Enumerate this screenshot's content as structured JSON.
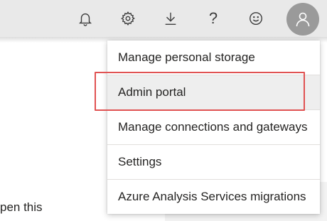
{
  "header": {
    "icons": [
      "notifications-icon",
      "gear-icon",
      "download-icon",
      "help-icon",
      "feedback-smiley-icon"
    ],
    "help_glyph": "?",
    "avatar_icon": "person-icon"
  },
  "account_menu": {
    "items": [
      {
        "label": "Manage personal storage"
      },
      {
        "label": "Admin portal",
        "state": "hovered",
        "highlighted": true
      },
      {
        "label": "Manage connections and gateways"
      },
      {
        "label": "Settings"
      },
      {
        "label": "Azure Analysis Services migrations"
      }
    ]
  },
  "background": {
    "partial_text": "pen this"
  },
  "colors": {
    "highlight_border": "#e05252",
    "avatar_bg": "#9a9a9a",
    "topbar_bg": "#e9e9e9"
  }
}
